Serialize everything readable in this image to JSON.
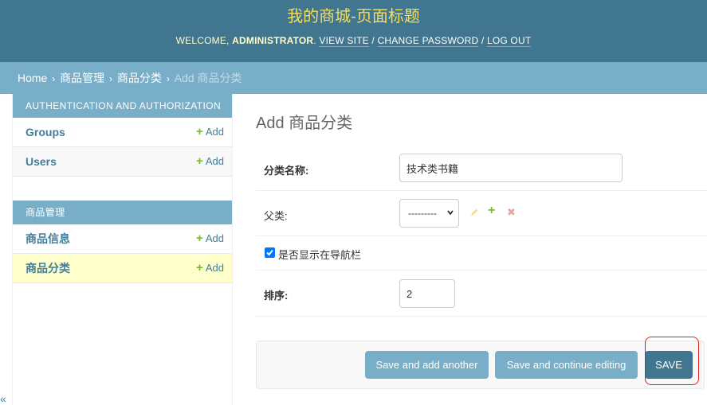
{
  "header": {
    "site_title": "我的商城-页面标题",
    "welcome_prefix": "WELCOME,",
    "username": "ADMINISTRATOR",
    "view_site": "VIEW SITE",
    "change_password": "CHANGE PASSWORD",
    "log_out": "LOG OUT",
    "separator": "/"
  },
  "breadcrumbs": {
    "home": "Home",
    "app": "商品管理",
    "model": "商品分类",
    "current": "Add 商品分类",
    "separator": "›"
  },
  "sidebar": {
    "modules": [
      {
        "caption": "AUTHENTICATION AND AUTHORIZATION",
        "models": [
          {
            "name": "Groups",
            "add": "Add"
          },
          {
            "name": "Users",
            "add": "Add"
          }
        ]
      },
      {
        "caption": "商品管理",
        "models": [
          {
            "name": "商品信息",
            "add": "Add"
          },
          {
            "name": "商品分类",
            "add": "Add"
          }
        ]
      }
    ],
    "collapse_toggle": "«"
  },
  "form": {
    "title": "Add 商品分类",
    "name_label": "分类名称:",
    "name_value": "技术类书籍",
    "parent_label": "父类:",
    "parent_selected": "---------",
    "show_in_nav_label": "是否显示在导航栏",
    "show_in_nav_checked": true,
    "order_label": "排序:",
    "order_value": "2"
  },
  "submit": {
    "save_add_another": "Save and add another",
    "save_continue": "Save and continue editing",
    "save": "SAVE"
  },
  "colors": {
    "header_bg": "#417690",
    "breadcrumb_bg": "#79aec8",
    "title_yellow": "#f5dd5d",
    "current_row_bg": "#ffffcc",
    "add_green": "#70bf2b",
    "highlight_red": "#e02020"
  },
  "icons": {
    "change_related": "pencil-icon",
    "add_related": "plus-icon",
    "delete_related": "x-icon"
  }
}
